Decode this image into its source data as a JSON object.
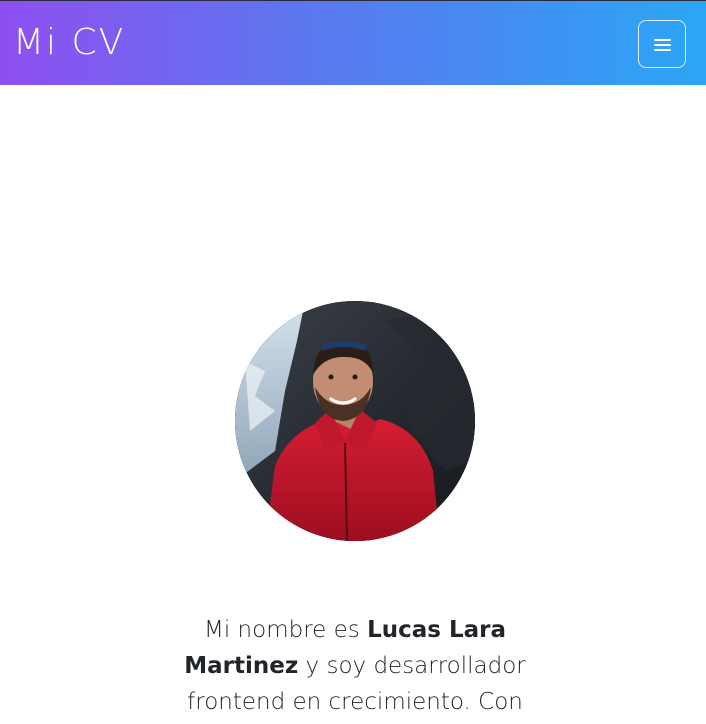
{
  "navbar": {
    "brand": "Mi CV",
    "toggle_icon": "hamburger-menu-icon",
    "gradient_start": "#8e4ff0",
    "gradient_end": "#2ba6f5"
  },
  "profile": {
    "photo_icon": "profile-photo",
    "intro_prefix": "Mi nombre es ",
    "name": "Lucas Lara Martinez",
    "intro_middle": " y soy desarrollador frontend en crecimiento. Con"
  }
}
